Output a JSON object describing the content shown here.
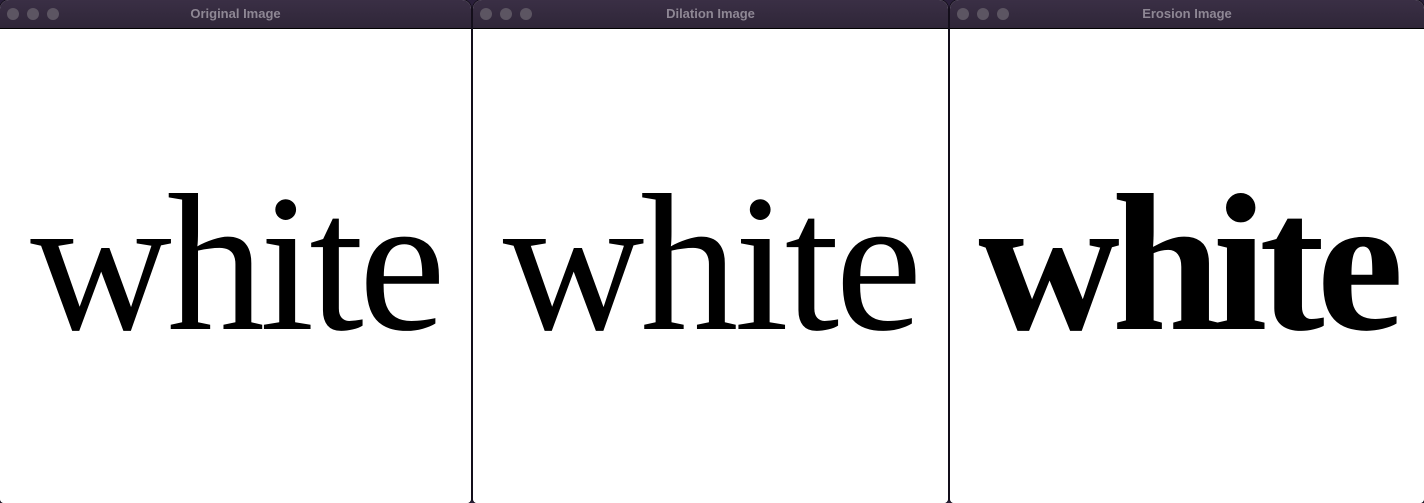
{
  "windows": [
    {
      "title": "Original Image",
      "word": "white"
    },
    {
      "title": "Dilation Image",
      "word": "white"
    },
    {
      "title": "Erosion Image",
      "word": "white"
    }
  ]
}
